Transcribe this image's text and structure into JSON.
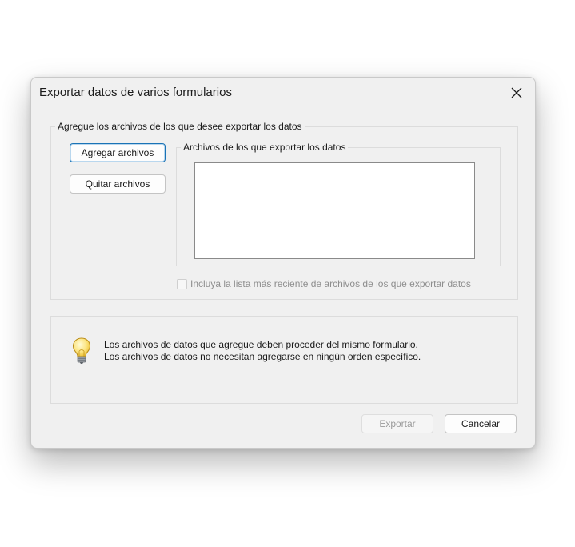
{
  "dialog": {
    "title": "Exportar datos de varios formularios",
    "close_icon": "close-icon"
  },
  "add_group": {
    "legend": "Agregue los archivos de los que desee exportar los datos",
    "add_button": "Agregar archivos",
    "remove_button": "Quitar archivos",
    "files_group": {
      "legend": "Archivos de los que exportar los datos",
      "items": []
    },
    "recent_checkbox": {
      "label": "Incluya la lista más reciente de archivos de los que exportar datos",
      "checked": false,
      "enabled": false
    }
  },
  "info": {
    "icon": "lightbulb-icon",
    "line1": "Los archivos de datos que agregue deben proceder del mismo formulario.",
    "line2": "Los archivos de datos no necesitan agregarse en ningún orden específico."
  },
  "footer": {
    "export_button": "Exportar",
    "export_enabled": false,
    "cancel_button": "Cancelar"
  }
}
